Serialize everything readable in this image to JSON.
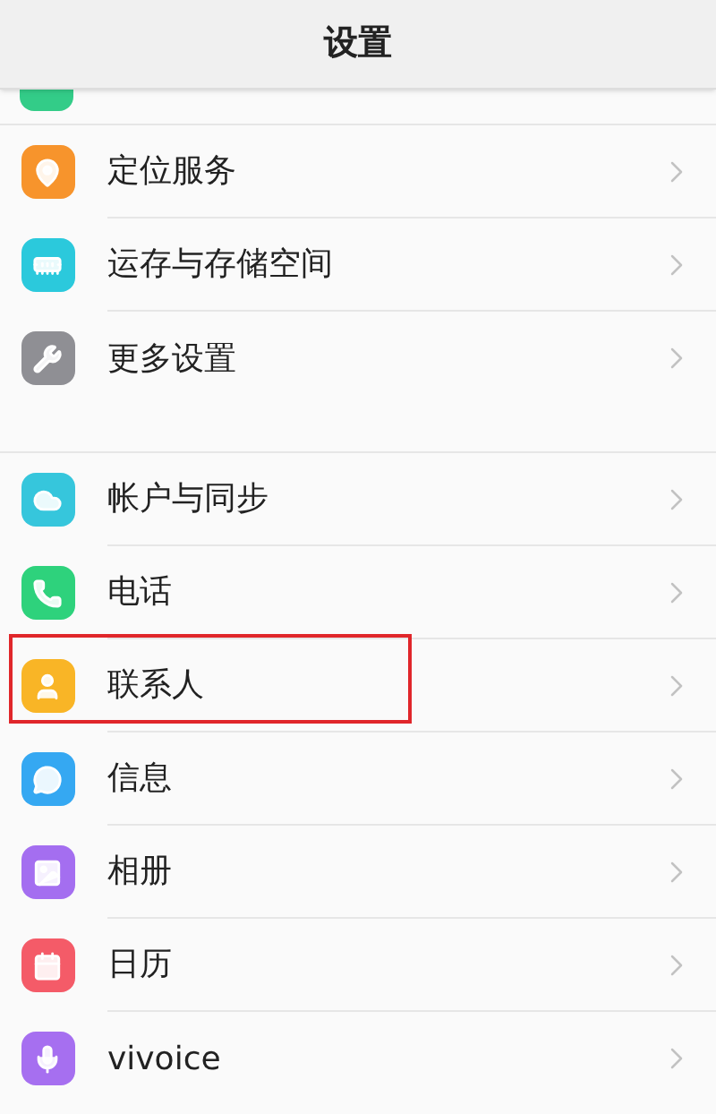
{
  "header": {
    "title": "设置"
  },
  "partial_item": {
    "color": "#33cc88"
  },
  "groups": [
    {
      "items": [
        {
          "label": "定位服务",
          "color": "#f7942c",
          "highlighted": false
        },
        {
          "label": "运存与存储空间",
          "color": "#2bc9dc",
          "highlighted": false
        },
        {
          "label": "更多设置",
          "color": "#8f8f94",
          "highlighted": false
        }
      ]
    },
    {
      "items": [
        {
          "label": "帐户与同步",
          "color": "#36c6dc",
          "highlighted": false
        },
        {
          "label": "电话",
          "color": "#2ed27c",
          "highlighted": false
        },
        {
          "label": "联系人",
          "color": "#f9b526",
          "highlighted": true
        },
        {
          "label": "信息",
          "color": "#35a8f2",
          "highlighted": false
        },
        {
          "label": "相册",
          "color": "#a46ef0",
          "highlighted": false
        },
        {
          "label": "日历",
          "color": "#f45b68",
          "highlighted": false
        },
        {
          "label": "vivoice",
          "color": "#a66ff0",
          "highlighted": false
        }
      ]
    }
  ]
}
